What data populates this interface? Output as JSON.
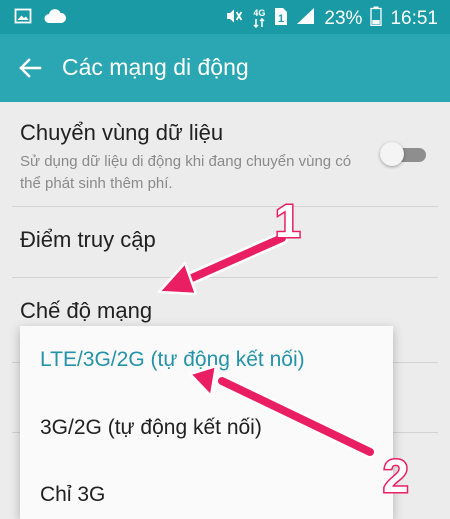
{
  "status_bar": {
    "left_icons": [
      "image-icon",
      "cloud-icon"
    ],
    "right_icons": [
      "mute-icon",
      "4g-lte-icon",
      "sim1-icon",
      "signal-icon",
      "battery-icon"
    ],
    "network_label": "4G",
    "sim_label": "1",
    "battery_percent": "23%",
    "time": "16:51"
  },
  "app_bar": {
    "title": "Các mạng di động",
    "back_icon": "arrow-left-icon"
  },
  "settings": {
    "roaming": {
      "title": "Chuyển vùng dữ liệu",
      "summary": "Sử dụng dữ liệu di động khi đang chuyển vùng có thể phát sinh thêm phí.",
      "enabled": false
    },
    "apn": {
      "title": "Điểm truy cập"
    },
    "network_mode": {
      "title": "Chế độ mạng"
    }
  },
  "network_mode_options": {
    "items": [
      "LTE/3G/2G (tự động kết nối)",
      "3G/2G (tự động kết nối)",
      "Chỉ 3G"
    ],
    "selected_index": 0
  },
  "annotations": {
    "step_1": "1",
    "step_2": "2",
    "color": "#e91e63"
  },
  "colors": {
    "status_bar": "#1a9aa5",
    "app_bar": "#2aa7b2",
    "accent": "#2493a9"
  }
}
